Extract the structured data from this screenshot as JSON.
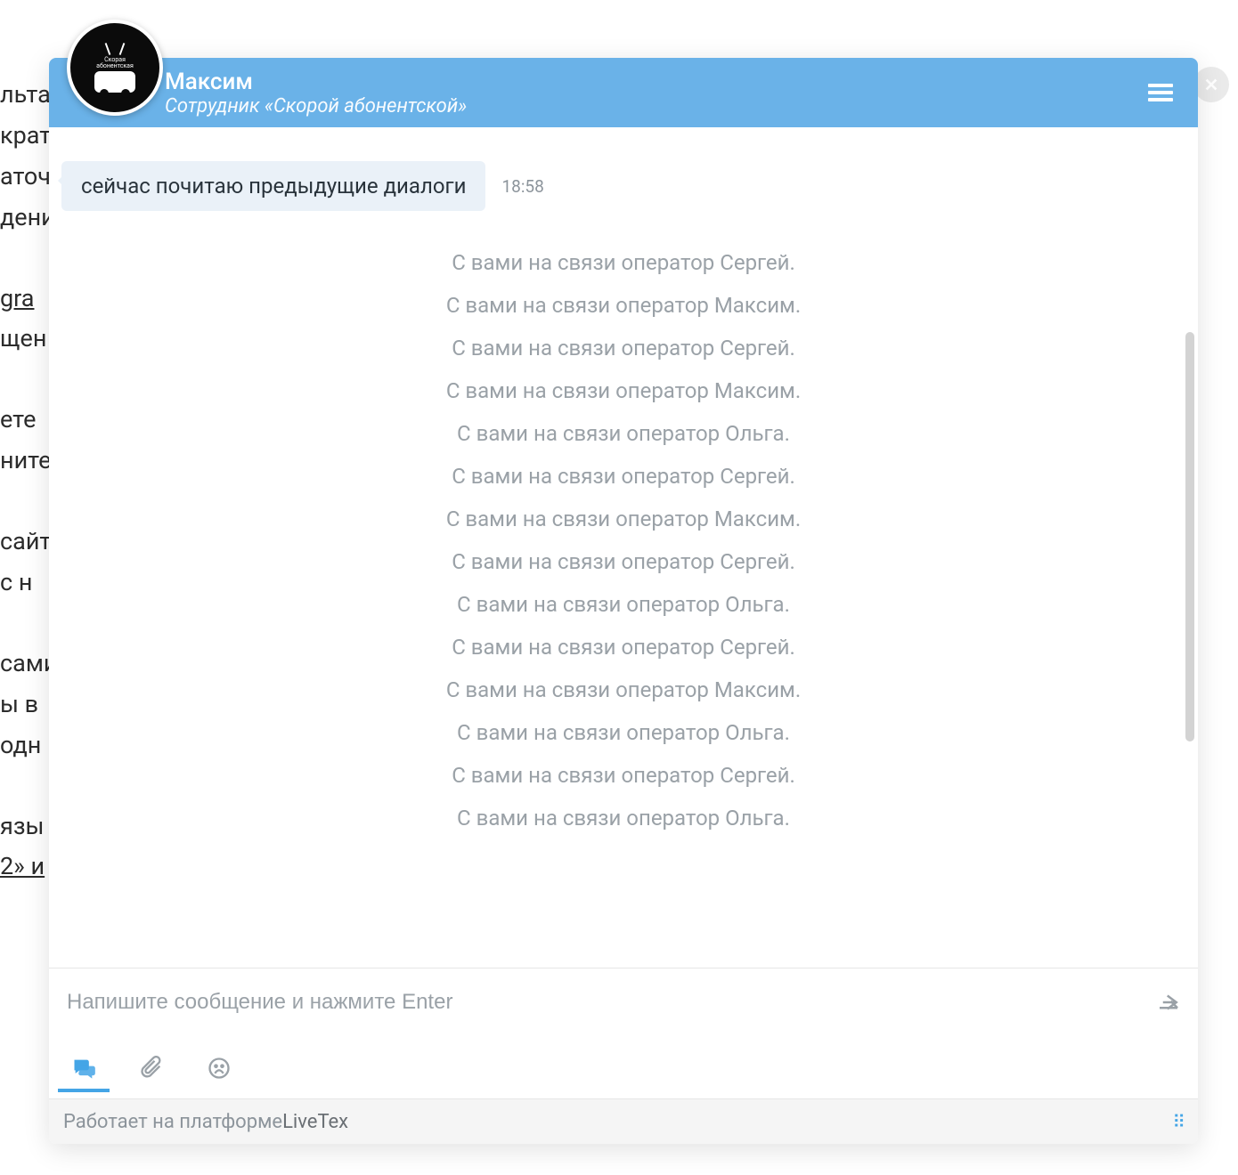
{
  "background_lines": [
    "льта",
    "крат",
    "аточ",
    "дени",
    "",
    "gra",
    "щен",
    "",
    "ете ",
    "ните",
    "",
    "сайт",
    " с н",
    "",
    "сами",
    "ы в",
    "одн",
    "",
    "язы",
    "2» и"
  ],
  "header": {
    "name": "Максим",
    "role": "Сотрудник «Скорой абонентской»"
  },
  "message": {
    "text": "сейчас почитаю предыдущие диалоги",
    "time": "18:58"
  },
  "system_messages": [
    "С вами на связи оператор Сергей.",
    "С вами на связи оператор Максим.",
    "С вами на связи оператор Сергей.",
    "С вами на связи оператор Максим.",
    "С вами на связи оператор Ольга.",
    "С вами на связи оператор Сергей.",
    "С вами на связи оператор Максим.",
    "С вами на связи оператор Сергей.",
    "С вами на связи оператор Ольга.",
    "С вами на связи оператор Сергей.",
    "С вами на связи оператор Максим.",
    "С вами на связи оператор Ольга.",
    "С вами на связи оператор Сергей.",
    "С вами на связи оператор Ольга."
  ],
  "input": {
    "placeholder": "Напишите сообщение и нажмите Enter"
  },
  "footer": {
    "powered": "Работает на платформе ",
    "brand": "LiveTex"
  },
  "colors": {
    "header_bg": "#6ab2e8",
    "accent": "#44a5e6",
    "bubble_bg": "#eaf1f8",
    "muted": "#9aa1a7"
  }
}
